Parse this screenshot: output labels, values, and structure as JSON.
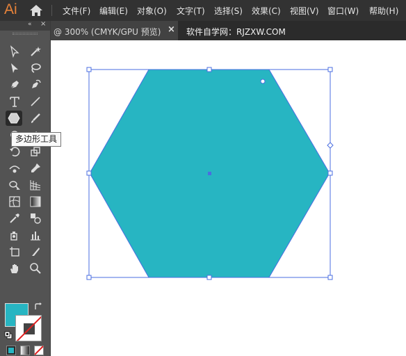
{
  "app": {
    "logo_text": "Ai",
    "home_icon": "home-icon"
  },
  "menu": {
    "items": [
      {
        "label": "文件(F)",
        "icon": null
      },
      {
        "label": "编辑(E)",
        "icon": null
      },
      {
        "label": "对象(O)",
        "icon": null
      },
      {
        "label": "文字(T)",
        "icon": null
      },
      {
        "label": "选择(S)",
        "icon": null
      },
      {
        "label": "效果(C)",
        "icon": null
      },
      {
        "label": "视图(V)",
        "icon": null
      },
      {
        "label": "窗口(W)",
        "icon": null
      },
      {
        "label": "帮助(H)",
        "icon": null
      }
    ]
  },
  "tabs": {
    "active_label": "@ 300% (CMYK/GPU 预览)",
    "close_glyph": "×",
    "second_label": "软件自学网：RJZXW.COM"
  },
  "toolbar": {
    "collapse_glyph": "«",
    "close_glyph": "×",
    "tooltip": "多边形工具",
    "tools": [
      "selection-tool-icon",
      "direct-selection-tool-icon",
      "magic-wand-tool-icon",
      "lasso-tool-icon",
      "pen-tool-icon",
      "curvature-tool-icon",
      "type-tool-icon",
      "line-segment-tool-icon",
      "polygon-tool-icon",
      "paintbrush-tool-icon",
      "shaper-tool-icon",
      "eraser-tool-icon",
      "rotate-tool-icon",
      "scale-tool-icon",
      "width-tool-icon",
      "puppet-warp-tool-icon",
      "shape-builder-tool-icon",
      "perspective-grid-tool-icon",
      "mesh-tool-icon",
      "gradient-tool-icon",
      "eyedropper-tool-icon",
      "blend-tool-icon",
      "symbol-sprayer-tool-icon",
      "column-graph-tool-icon",
      "artboard-tool-icon",
      "slice-tool-icon",
      "hand-tool-icon",
      "zoom-tool-icon"
    ],
    "active_tool": "polygon-tool-icon"
  },
  "colors": {
    "fill": "#27b5c2",
    "stroke": "none",
    "selection": "#4a6ee0",
    "ui_dark": "#323232",
    "toolbar": "#535353",
    "canvas": "#ffffff",
    "logo": "#e8833a"
  }
}
